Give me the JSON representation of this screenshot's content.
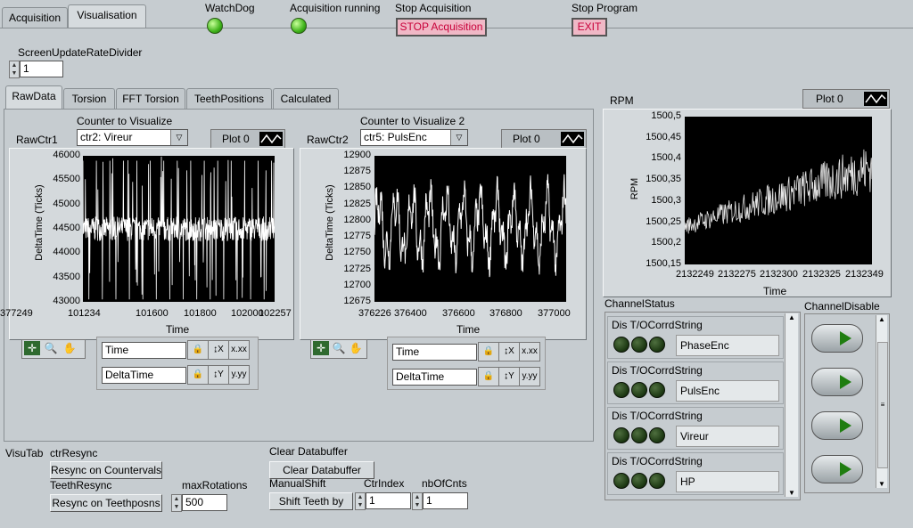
{
  "top_tabs": [
    {
      "label": "Acquisition"
    },
    {
      "label": "Visualisation"
    }
  ],
  "status": {
    "watchdog": "WatchDog",
    "acq_running": "Acquisition running",
    "stop_acq_label": "Stop Acquisition",
    "stop_acq_button": "STOP Acquisition",
    "stop_prog_label": "Stop Program",
    "exit_button": "EXIT"
  },
  "screen_update": {
    "label": "ScreenUpdateRateDivider",
    "value": "1"
  },
  "sub_tabs": [
    {
      "label": "RawData"
    },
    {
      "label": "Torsion"
    },
    {
      "label": "FFT Torsion"
    },
    {
      "label": "TeethPositions"
    },
    {
      "label": "Calculated"
    }
  ],
  "rawctr1": {
    "title": "RawCtr1",
    "counter_label": "Counter to Visualize",
    "counter_value": "ctr2: Vireur",
    "plot_label": "Plot 0",
    "ylabel": "DeltaTime (Ticks)",
    "xlabel": "Time",
    "yticks": [
      "46000",
      "45500",
      "45000",
      "44500",
      "44000",
      "43500",
      "43000"
    ],
    "xticks": [
      "101234",
      "101600",
      "101800",
      "102000",
      "102257"
    ],
    "x_name": "Time",
    "y_name": "DeltaTime"
  },
  "rawctr2": {
    "title": "RawCtr2",
    "counter_label": "Counter to Visualize 2",
    "counter_value": "ctr5: PulsEnc",
    "plot_label": "Plot 0",
    "ylabel": "DeltaTime (Ticks)",
    "xlabel": "Time",
    "yticks": [
      "12900",
      "12875",
      "12850",
      "12825",
      "12800",
      "12775",
      "12750",
      "12725",
      "12700",
      "12675"
    ],
    "xticks": [
      "376226",
      "376400",
      "376600",
      "376800",
      "377000",
      "377249"
    ],
    "x_name": "Time",
    "y_name": "DeltaTime"
  },
  "rpm": {
    "title": "RPM",
    "plot_label": "Plot 0",
    "ylabel": "RPM",
    "xlabel": "Time",
    "yticks": [
      "1500,5",
      "1500,45",
      "1500,4",
      "1500,35",
      "1500,3",
      "1500,25",
      "1500,2",
      "1500,15"
    ],
    "xticks": [
      "2132249",
      "2132275",
      "2132300",
      "2132325",
      "2132349"
    ]
  },
  "channel_status": {
    "title": "ChannelStatus",
    "header": "Dis  T/OCorrdString",
    "channels": [
      {
        "name": "PhaseEnc"
      },
      {
        "name": "PulsEnc"
      },
      {
        "name": "Vireur"
      },
      {
        "name": "HP"
      }
    ]
  },
  "channel_disable": {
    "title": "ChannelDisable"
  },
  "bottom": {
    "visutab": "VisuTab",
    "ctrresync_label": "ctrResync",
    "ctrresync_button": "Resync on Countervals",
    "teethresync_label": "TeethResync",
    "teethresync_button": "Resync on Teethposns",
    "maxrot_label": "maxRotations",
    "maxrot_value": "500",
    "clear_label": "Clear Databuffer",
    "clear_button": "Clear Databuffer",
    "manualshift_label": "ManualShift",
    "shift_button": "Shift Teeth by",
    "ctrindex_label": "CtrIndex",
    "ctrindex_value": "1",
    "nbofcnts_label": "nbOfCnts",
    "nbofcnts_value": "1"
  },
  "colors": {
    "panel": "#c6ccd0",
    "plot_bg": "#000000",
    "trace": "#ffffff",
    "led_on": "#3fb31a",
    "alert": "#c8003a"
  }
}
